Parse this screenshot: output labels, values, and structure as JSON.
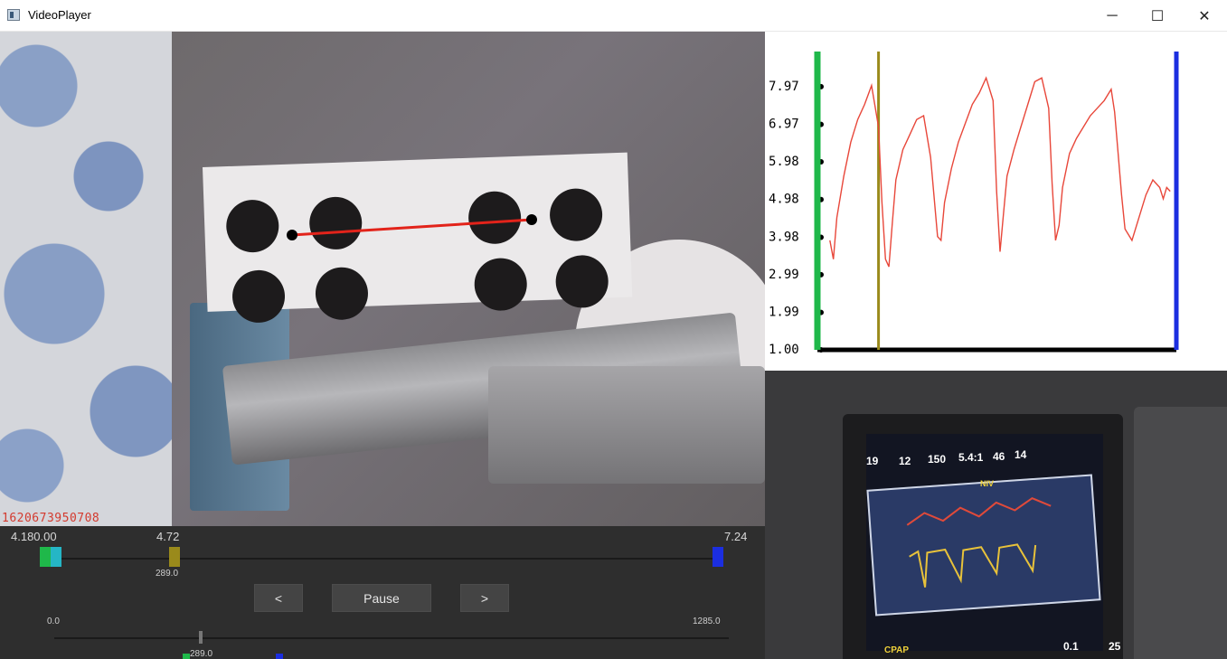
{
  "window": {
    "title": "VideoPlayer",
    "min_symbol": "─",
    "max_symbol": "☐",
    "close_symbol": "✕"
  },
  "camera": {
    "timestamp": "1620673950708"
  },
  "controls": {
    "slider1": {
      "left_value": "4.180.00",
      "marker_value": "4.72",
      "right_value": "7.24",
      "marker_sub": "289.0"
    },
    "buttons": {
      "prev": "<",
      "pause": "Pause",
      "next": ">"
    },
    "slider2": {
      "min_value": "0.0",
      "max_value": "1285.0",
      "marker_sub": "289.0"
    }
  },
  "chart_data": {
    "type": "line",
    "title": "",
    "xlabel": "",
    "ylabel": "",
    "y_ticks": [
      "1.00",
      "1.99",
      "2.99",
      "3.98",
      "4.98",
      "5.98",
      "6.97",
      "7.97"
    ],
    "ylim": [
      1.0,
      8.9
    ],
    "xlim": [
      0,
      100
    ],
    "grid": false,
    "series": [
      {
        "color": "#e8473a",
        "x": [
          1,
          2,
          3,
          5,
          7,
          9,
          11,
          13,
          15,
          16,
          17,
          18,
          19,
          20,
          22,
          24,
          26,
          28,
          30,
          32,
          33,
          34,
          36,
          38,
          40,
          42,
          44,
          46,
          48,
          49,
          50,
          51,
          52,
          54,
          56,
          58,
          60,
          62,
          64,
          65,
          66,
          67,
          68,
          70,
          72,
          74,
          76,
          78,
          80,
          82,
          83,
          84,
          85,
          86,
          88,
          90,
          92,
          94,
          96,
          97,
          98,
          99
        ],
        "y": [
          3.9,
          3.4,
          4.5,
          5.6,
          6.5,
          7.1,
          7.5,
          8.0,
          6.9,
          4.9,
          3.4,
          3.2,
          4.4,
          5.5,
          6.3,
          6.7,
          7.1,
          7.2,
          6.1,
          4.0,
          3.9,
          4.9,
          5.8,
          6.5,
          7.0,
          7.5,
          7.8,
          8.2,
          7.6,
          5.2,
          3.6,
          4.6,
          5.6,
          6.3,
          6.9,
          7.5,
          8.1,
          8.2,
          7.4,
          5.4,
          3.9,
          4.3,
          5.3,
          6.2,
          6.6,
          6.9,
          7.2,
          7.4,
          7.6,
          7.9,
          7.3,
          6.2,
          5.1,
          4.2,
          3.9,
          4.5,
          5.1,
          5.5,
          5.3,
          5.0,
          5.3,
          5.2
        ]
      }
    ],
    "cursor_x": 15,
    "colors": {
      "left_bar": "#1fb84a",
      "cursor": "#9a8a1b",
      "right_bar": "#1b2ee0",
      "axis": "#000000"
    }
  },
  "monitor": {
    "readouts": [
      "19",
      "12",
      "150",
      "5.4:1",
      "46",
      "14"
    ],
    "mode_label": "NIV",
    "bottom_label": "CPAP",
    "vt_value": "0.1",
    "o2_value": "25"
  }
}
